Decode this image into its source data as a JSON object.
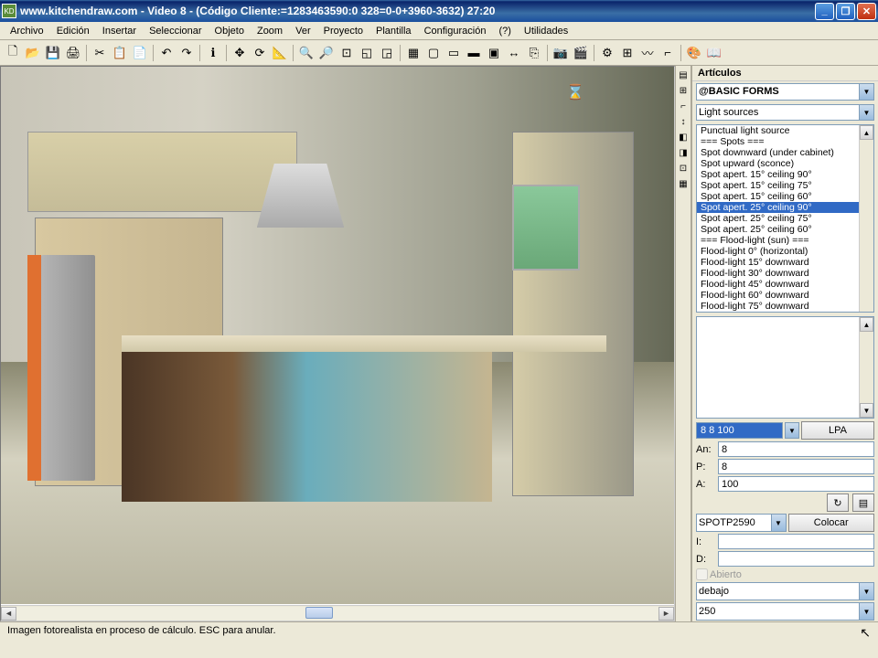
{
  "titlebar": {
    "url": "www.kitchendraw.com",
    "title": " - Video 8 - (Código Cliente:=1283463590:0 328=0-0+3960-3632) 27:20"
  },
  "menu": [
    "Archivo",
    "Edición",
    "Insertar",
    "Seleccionar",
    "Objeto",
    "Zoom",
    "Ver",
    "Proyecto",
    "Plantilla",
    "Configuración",
    "(?)",
    "Utilidades"
  ],
  "toolbar_icons": [
    "new",
    "open",
    "save",
    "print",
    "|",
    "cut",
    "copy",
    "paste",
    "|",
    "undo",
    "redo",
    "|",
    "info",
    "|",
    "move",
    "rotate",
    "measure",
    "|",
    "zoom-in",
    "zoom-out",
    "zoom-fit",
    "zoom-win",
    "zoom-sel",
    "|",
    "layer",
    "grid",
    "rect",
    "fill",
    "group",
    "dim",
    "link",
    "|",
    "camera",
    "render",
    "|",
    "tool-a",
    "tool-b",
    "curve",
    "wall",
    "|",
    "palette",
    "book"
  ],
  "side_tools": [
    "t1",
    "t2",
    "t3",
    "t4",
    "t5",
    "t6",
    "t7",
    "t8"
  ],
  "panel": {
    "header": "Artículos",
    "catalog": "@BASIC FORMS",
    "category": "Light sources",
    "items": [
      "Punctual light source",
      "=== Spots ===",
      "Spot downward (under cabinet)",
      "Spot upward (sconce)",
      "Spot apert. 15° ceiling 90°",
      "Spot apert. 15° ceiling 75°",
      "Spot apert. 15° ceiling 60°",
      "Spot apert. 25° ceiling 90°",
      "Spot apert. 25° ceiling 75°",
      "Spot apert. 25° ceiling 60°",
      "=== Flood-light (sun) ===",
      "Flood-light 0° (horizontal)",
      "Flood-light 15° downward",
      "Flood-light 30° downward",
      "Flood-light 45° downward",
      "Flood-light 60° downward",
      "Flood-light 75° downward"
    ],
    "selected_index": 7,
    "blue_field": "8   8  100",
    "lpa_button": "LPA",
    "dims": {
      "an_label": "An:",
      "an": "8",
      "p_label": "P:",
      "p": "8",
      "a_label": "A:",
      "a": "100"
    },
    "ref": "SPOTP2590",
    "colocar": "Colocar",
    "i_label": "I:",
    "d_label": "D:",
    "abierto": "Abierto",
    "debajo": "debajo",
    "num250": "250"
  },
  "status": {
    "text": "Imagen fotorealista en proceso de cálculo. ESC para anular."
  }
}
